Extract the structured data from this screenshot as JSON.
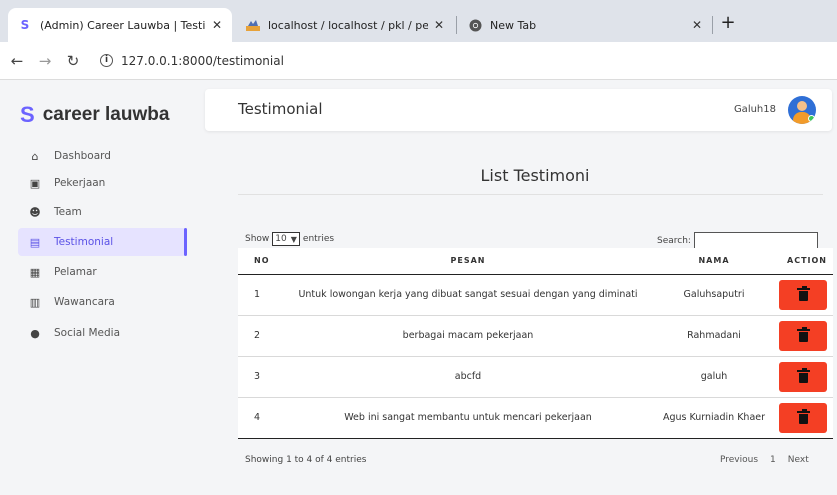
{
  "browser": {
    "tabs": [
      {
        "title": "(Admin) Career Lauwba | Testimo",
        "close": "✕",
        "icon": "purple-s-logo"
      },
      {
        "title": "localhost / localhost / pkl / pelam",
        "close": "✕",
        "icon": "phpmyadmin-icon"
      },
      {
        "title": "New Tab",
        "close": "✕",
        "icon": "chrome-icon"
      }
    ],
    "new_tab": "+",
    "url": "127.0.0.1:8000/testimonial"
  },
  "sidebar": {
    "brand": "career lauwba",
    "items": [
      {
        "label": "Dashboard",
        "icon": "home-icon",
        "glyph": "⌂"
      },
      {
        "label": "Pekerjaan",
        "icon": "briefcase-icon",
        "glyph": "▣"
      },
      {
        "label": "Team",
        "icon": "users-icon",
        "glyph": "👥"
      },
      {
        "label": "Testimonial",
        "icon": "comment-icon",
        "glyph": "▤"
      },
      {
        "label": "Pelamar",
        "icon": "id-card-icon",
        "glyph": "▦"
      },
      {
        "label": "Wawancara",
        "icon": "calendar-icon",
        "glyph": "▥"
      },
      {
        "label": "Social Media",
        "icon": "chat-bubble-icon",
        "glyph": "●"
      }
    ]
  },
  "header": {
    "title": "Testimonial",
    "username": "Galuh18"
  },
  "main": {
    "list_title": "List Testimoni",
    "show_label": "Show",
    "entries_value": "10",
    "entries_label": "entries",
    "search_label": "Search:",
    "columns": [
      "NO",
      "PESAN",
      "NAMA",
      "ACTION"
    ],
    "rows": [
      {
        "no": "1",
        "pesan": "Untuk lowongan kerja yang dibuat sangat sesuai dengan yang diminati",
        "nama": "Galuhsaputri"
      },
      {
        "no": "2",
        "pesan": "berbagai macam pekerjaan",
        "nama": "Rahmadani"
      },
      {
        "no": "3",
        "pesan": "abcfd",
        "nama": "galuh"
      },
      {
        "no": "4",
        "pesan": "Web ini sangat membantu untuk mencari pekerjaan",
        "nama": "Agus Kurniadin Khaer"
      }
    ],
    "info": "Showing 1 to 4 of 4 entries",
    "pager": {
      "previous": "Previous",
      "page": "1",
      "next": "Next"
    }
  },
  "colors": {
    "accent": "#6c63ff",
    "delete": "#f43f24",
    "active_bg": "#e6e3ff"
  }
}
